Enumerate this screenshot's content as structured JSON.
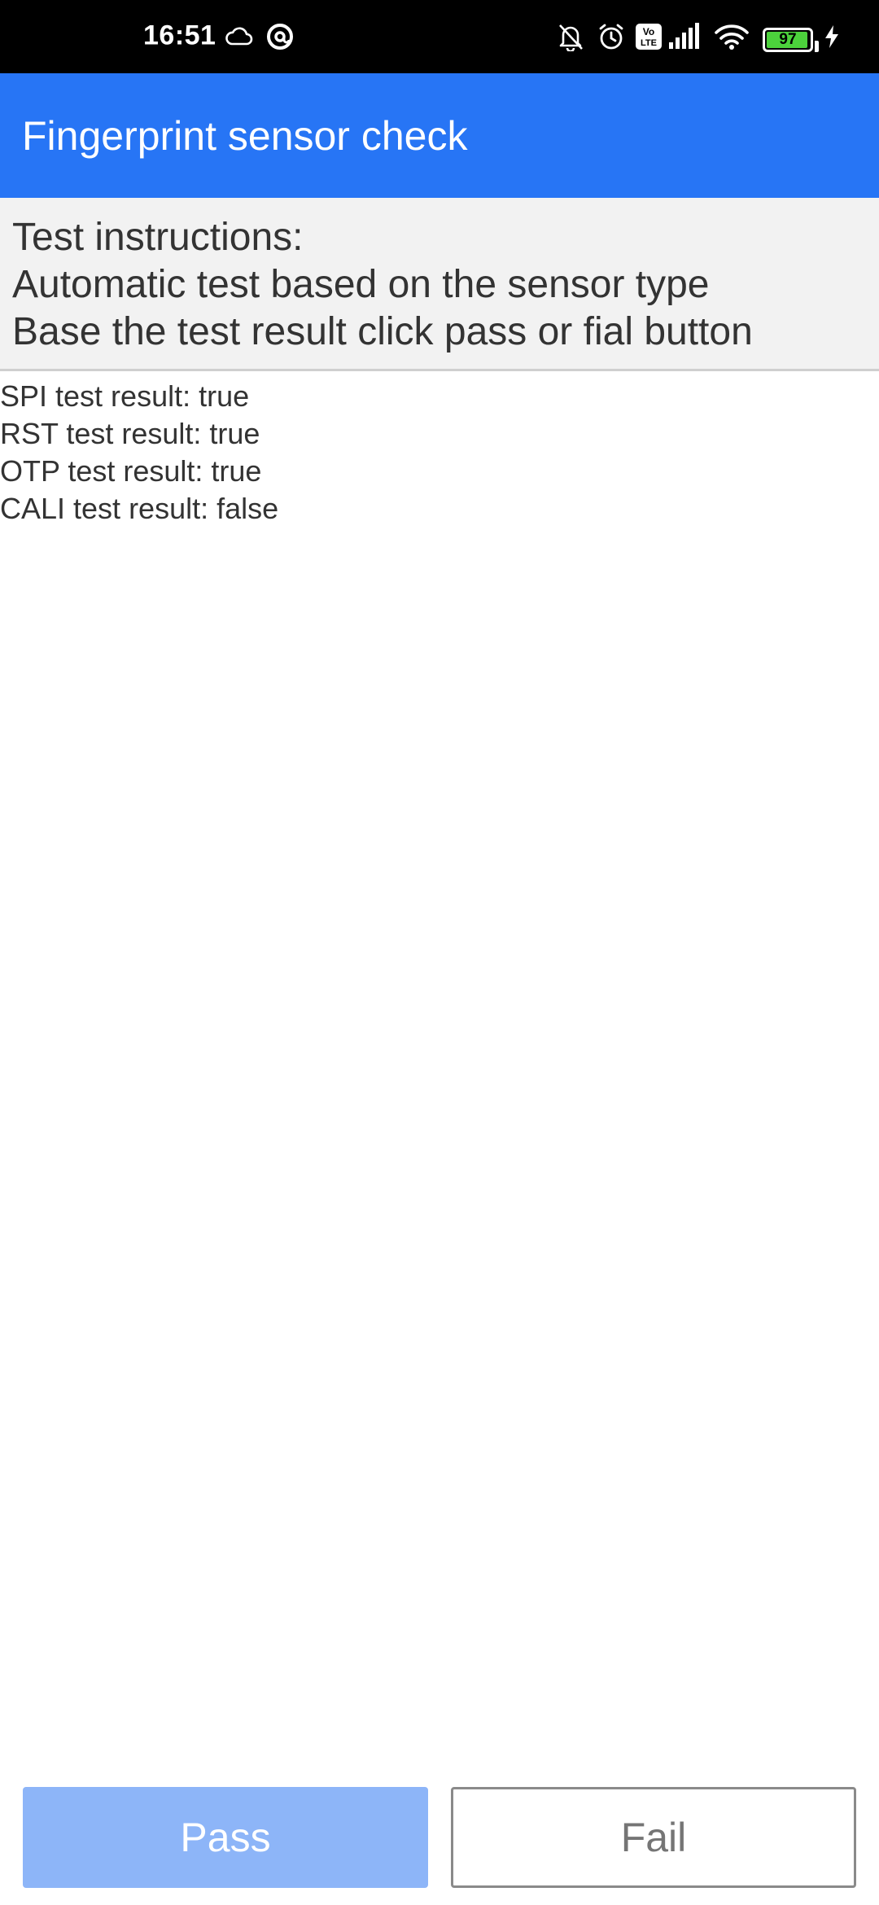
{
  "status_bar": {
    "time": "16:51",
    "icons": [
      "cloud-icon",
      "at-sign-icon",
      "bell-off-icon",
      "alarm-icon",
      "volte-icon",
      "signal-icon",
      "wifi-icon",
      "battery-icon",
      "charging-icon"
    ],
    "volte_label_top": "Vo",
    "volte_label_bottom": "LTE",
    "battery_level": 97,
    "battery_text": "97",
    "battery_color": "#4cd23c"
  },
  "app_bar": {
    "title": "Fingerprint sensor check",
    "color": "#2775f5"
  },
  "instructions": {
    "lines": [
      "Test instructions:",
      "Automatic test based on the sensor type",
      "Base the test result click pass or fial button"
    ]
  },
  "results": [
    "SPI test result: true",
    "RST test result: true",
    "OTP test result: true",
    "CALI test result: false"
  ],
  "buttons": {
    "pass_label": "Pass",
    "fail_label": "Fail",
    "pass_color": "#8db5f8"
  }
}
